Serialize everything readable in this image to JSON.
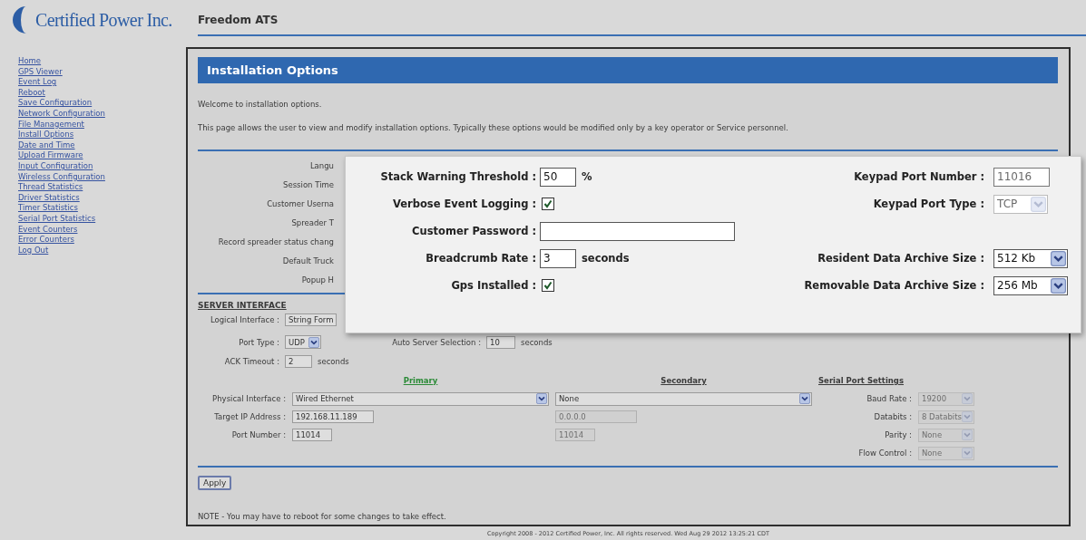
{
  "header": {
    "brand": "Certified Power Inc.",
    "title": "Freedom ATS"
  },
  "nav": [
    {
      "label": "Home"
    },
    {
      "label": "GPS Viewer"
    },
    {
      "label": "Event Log"
    },
    {
      "label": "Reboot"
    },
    {
      "label": "Save Configuration"
    },
    {
      "label": "Network Configuration"
    },
    {
      "label": "File Management"
    },
    {
      "label": "Install Options"
    },
    {
      "label": "Date and Time"
    },
    {
      "label": "Upload Firmware"
    },
    {
      "label": "Input Configuration"
    },
    {
      "label": "Wireless Configuration"
    },
    {
      "label": "Thread Statistics"
    },
    {
      "label": "Driver Statistics"
    },
    {
      "label": "Timer Statistics"
    },
    {
      "label": "Serial Port Statistics"
    },
    {
      "label": "Event Counters"
    },
    {
      "label": "Error Counters"
    },
    {
      "label": "Log Out"
    }
  ],
  "panel": {
    "title": "Installation Options",
    "intro": "Welcome to installation options.",
    "description": "This page allows the user to view and modify installation options. Typically these options would be modified only by a key operator or Service personnel."
  },
  "option_labels": [
    "Langu",
    "Session Time",
    "Customer Userna",
    "Spreader T",
    "Record spreader status chang",
    "Default Truck",
    "Popup H"
  ],
  "server_interface": {
    "heading": "SERVER INTERFACE",
    "logical_interface": {
      "label": "Logical Interface :",
      "value": "String Form"
    },
    "port_type": {
      "label": "Port Type :",
      "value": "UDP"
    },
    "auto_server_selection": {
      "label": "Auto Server Selection :",
      "value": "10",
      "unit": "seconds"
    },
    "ack_timeout": {
      "label": "ACK Timeout :",
      "value": "2",
      "unit": "seconds"
    }
  },
  "connections": {
    "primary_heading": "Primary",
    "secondary_heading": "Secondary",
    "serial_heading": "Serial Port Settings",
    "rows": [
      {
        "label": "Physical Interface :",
        "primary": {
          "kind": "select",
          "value": "Wired Ethernet",
          "disabled": false
        },
        "secondary": {
          "kind": "select",
          "value": "None",
          "disabled": false
        },
        "serial": {
          "label": "Baud Rate :",
          "value": "19200",
          "disabled": true
        }
      },
      {
        "label": "Target IP Address :",
        "primary": {
          "kind": "ip",
          "value": "192.168.11.189",
          "disabled": false
        },
        "secondary": {
          "kind": "ip",
          "value": "0.0.0.0",
          "disabled": true
        },
        "serial": {
          "label": "Databits :",
          "value": "8 Databits",
          "disabled": true
        }
      },
      {
        "label": "Port Number :",
        "primary": {
          "kind": "port",
          "value": "11014",
          "disabled": false
        },
        "secondary": {
          "kind": "port",
          "value": "11014",
          "disabled": true
        },
        "serial": {
          "label": "Parity :",
          "value": "None",
          "disabled": true
        }
      },
      {
        "serial": {
          "label": "Flow Control :",
          "value": "None",
          "disabled": true
        }
      }
    ]
  },
  "apply_button": "Apply",
  "note": "NOTE - You may have to reboot for some changes to take effect.",
  "copyright": "Copyright 2008 - 2012 Certified Power, Inc. All rights reserved. Wed Aug 29 2012 13:25:21 CDT",
  "popup": {
    "rows": [
      {
        "left": {
          "kind": "text",
          "label": "Stack Warning Threshold :",
          "value": "50",
          "unit": "%"
        },
        "right": {
          "kind": "text",
          "label": "Keypad Port Number :",
          "value": "11016",
          "disabled": true
        }
      },
      {
        "left": {
          "kind": "checkbox",
          "label": "Verbose Event Logging :",
          "checked": true
        },
        "right": {
          "kind": "select",
          "label": "Keypad Port Type :",
          "value": "TCP",
          "disabled": true
        }
      },
      {
        "left": {
          "kind": "password",
          "label": "Customer Password :"
        }
      },
      {
        "left": {
          "kind": "text",
          "label": "Breadcrumb Rate :",
          "value": "3",
          "unit": "seconds"
        },
        "right": {
          "kind": "select",
          "label": "Resident Data Archive Size :",
          "value": "512 Kb",
          "disabled": false
        }
      },
      {
        "left": {
          "kind": "checkbox",
          "label": "Gps Installed :",
          "checked": true
        },
        "right": {
          "kind": "select",
          "label": "Removable Data Archive Size :",
          "value": "256 Mb",
          "disabled": false
        }
      }
    ]
  }
}
